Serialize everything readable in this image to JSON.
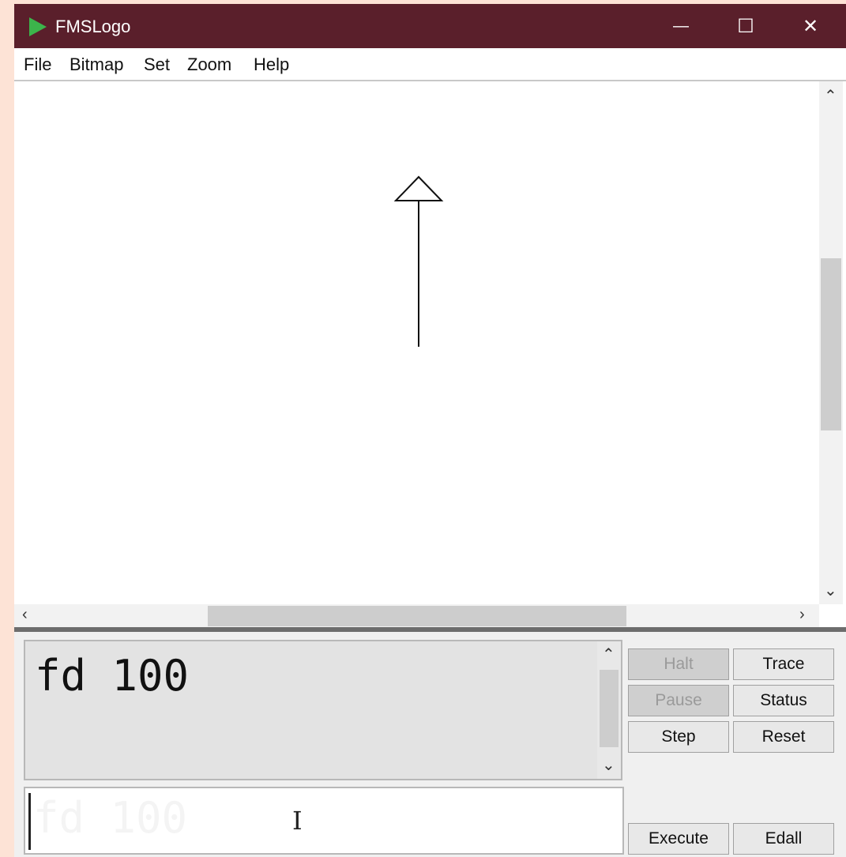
{
  "window": {
    "title": "FMSLogo"
  },
  "title_buttons": {
    "minimize": "—",
    "maximize": "☐",
    "close": "✕"
  },
  "menu": [
    "File",
    "Bitmap",
    "Set",
    "Zoom",
    "Help"
  ],
  "history": {
    "text": "fd 100"
  },
  "input": {
    "ghost_text": "fd 100",
    "cursor": "I"
  },
  "buttons": {
    "halt": "Halt",
    "trace": "Trace",
    "pause": "Pause",
    "status": "Status",
    "step": "Step",
    "reset": "Reset",
    "execute": "Execute",
    "edall": "Edall"
  },
  "colors": {
    "titlebar": "#5a1f2b",
    "app_icon": "#3cb44b",
    "page_bg": "#fde3d6"
  }
}
